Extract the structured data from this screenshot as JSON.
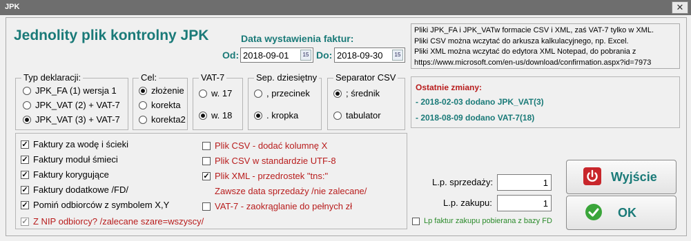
{
  "window": {
    "title": "JPK",
    "close_glyph": "✕"
  },
  "app_title": "Jednolity plik kontrolny JPK",
  "dates": {
    "label": "Data wystawienia faktur:",
    "from_label": "Od:",
    "from_value": "2018-09-01",
    "to_label": "Do:",
    "to_value": "2018-09-30",
    "cal_glyph": "15"
  },
  "info_lines": [
    "Pliki JPK_FA i JPK_VATw formacie CSV i XML, zaś VAT-7 tylko w XML.",
    "Pliki CSV można wczytać do arkusza kalkulacyjnego, np. Excel.",
    "Pliki XML można wczytać do edytora XML Notepad, do pobrania z",
    "https://www.microsoft.com/en-us/download/confirmation.aspx?id=7973"
  ],
  "typ": {
    "title": "Typ deklaracji:",
    "options": [
      "JPK_FA (1) wersja 1",
      "JPK_VAT (2) + VAT-7",
      "JPK_VAT (3) + VAT-7"
    ],
    "selected": 2
  },
  "cel": {
    "title": "Cel:",
    "options": [
      "złożenie",
      "korekta",
      "korekta2"
    ],
    "selected": 0
  },
  "vat7": {
    "title": "VAT-7",
    "options": [
      "w. 17",
      "w. 18"
    ],
    "selected": 1
  },
  "sep_dec": {
    "title": "Sep. dziesiętny",
    "options": [
      ", przecinek",
      ". kropka"
    ],
    "selected": 1
  },
  "sep_csv": {
    "title": "Separator CSV",
    "options": [
      "; średnik",
      "tabulator"
    ],
    "selected": 0
  },
  "changes": {
    "title": "Ostatnie zmiany:",
    "items": [
      "- 2018-02-03 dodano JPK_VAT(3)",
      "- 2018-08-09 dodano VAT-7(18)"
    ]
  },
  "checks_left": [
    {
      "label": "Faktury za wodę i ścieki",
      "checked": true
    },
    {
      "label": "Faktury moduł śmieci",
      "checked": true
    },
    {
      "label": "Faktury korygujące",
      "checked": true
    },
    {
      "label": "Faktury dodatkowe /FD/",
      "checked": true
    },
    {
      "label": "Pomiń odbiorców z symbolem X,Y",
      "checked": true
    },
    {
      "label": "Z NIP odbiorcy? /zalecane szare=wszyscy/",
      "checked": true
    }
  ],
  "checks_right": [
    {
      "label": "Plik CSV - dodać kolumnę X",
      "checked": false
    },
    {
      "label": "Plik CSV w standardzie UTF-8",
      "checked": false
    },
    {
      "label": "Plik XML - przedrostek \"tns:\"",
      "checked": true
    },
    {
      "label": "Zawsze data sprzedaży /nie zalecane/",
      "checked": false
    },
    {
      "label": "VAT-7 - zaokrąglanie do pełnych zł",
      "checked": false
    }
  ],
  "lp_sprzedazy": {
    "label": "L.p. sprzedaży:",
    "value": "1"
  },
  "lp_zakupu": {
    "label": "L.p. zakupu:",
    "value": "1"
  },
  "lp_fd": {
    "label": "Lp faktur zakupu pobierana z bazy FD",
    "checked": false
  },
  "buttons": {
    "exit_label": "Wyjście",
    "ok_label": "OK",
    "check_glyph": "✓"
  },
  "colors": {
    "accent": "#1a7a78",
    "red": "#b81c1c",
    "exit_icon": "#c8262b",
    "ok_icon": "#3aa53a"
  }
}
